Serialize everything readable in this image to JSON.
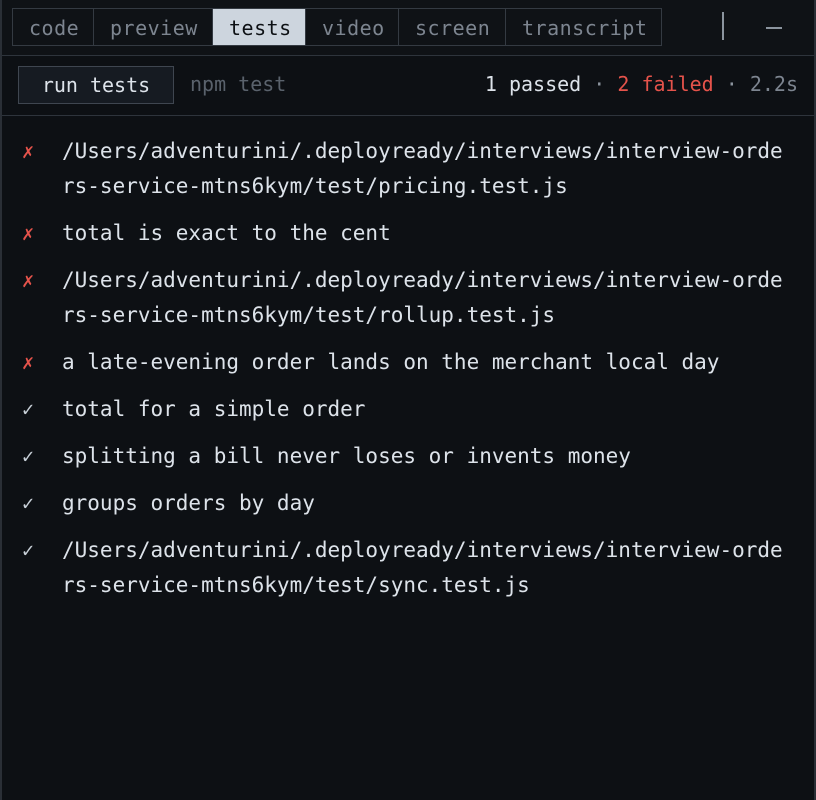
{
  "tabs": [
    {
      "label": "code",
      "active": false
    },
    {
      "label": "preview",
      "active": false
    },
    {
      "label": "tests",
      "active": true
    },
    {
      "label": "video",
      "active": false
    },
    {
      "label": "screen",
      "active": false
    },
    {
      "label": "transcript",
      "active": false
    }
  ],
  "toolbar": {
    "run_label": "run tests",
    "command": "npm test",
    "passed": "1 passed",
    "separator": "·",
    "failed": "2 failed",
    "duration": "2.2s"
  },
  "results": [
    {
      "status": "fail",
      "mark": "✗",
      "text": "/Users/adventurini/.deployready/interviews/interview-orders-service-mtns6kym/test/pricing.test.js"
    },
    {
      "status": "fail",
      "mark": "✗",
      "text": "total is exact to the cent"
    },
    {
      "status": "fail",
      "mark": "✗",
      "text": "/Users/adventurini/.deployready/interviews/interview-orders-service-mtns6kym/test/rollup.test.js"
    },
    {
      "status": "fail",
      "mark": "✗",
      "text": "a late-evening order lands on the merchant local day"
    },
    {
      "status": "pass",
      "mark": "✓",
      "text": "total for a simple order"
    },
    {
      "status": "pass",
      "mark": "✓",
      "text": "splitting a bill never loses or invents money"
    },
    {
      "status": "pass",
      "mark": "✓",
      "text": "groups orders by day"
    },
    {
      "status": "pass",
      "mark": "✓",
      "text": "/Users/adventurini/.deployready/interviews/interview-orders-service-mtns6kym/test/sync.test.js"
    }
  ],
  "colors": {
    "background": "#0d1014",
    "fail": "#e5534b",
    "active_tab": "#cdd5de"
  }
}
